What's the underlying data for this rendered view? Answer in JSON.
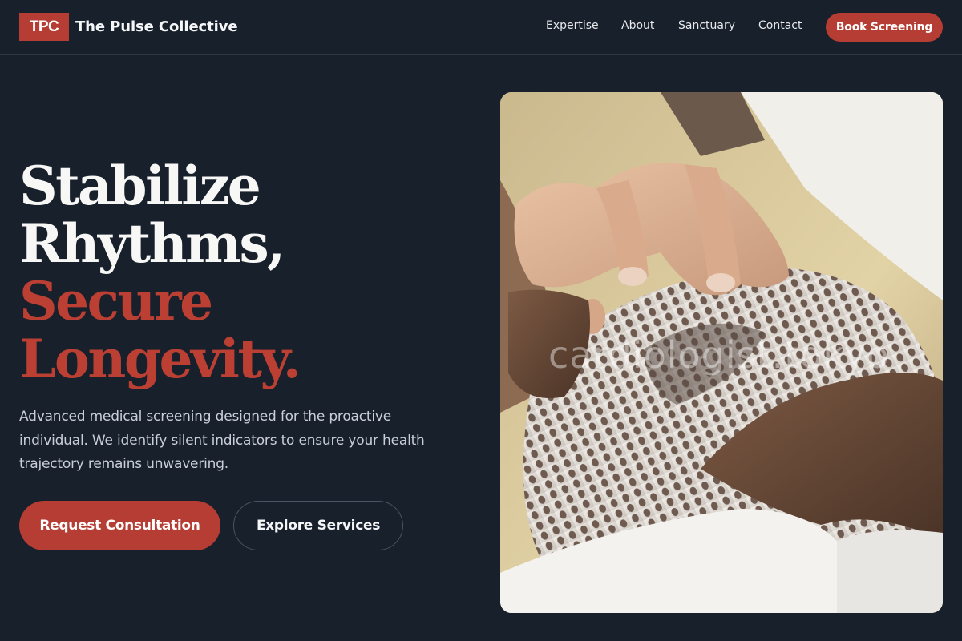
{
  "header": {
    "logo_text": "TPC",
    "brand_name": "The Pulse Collective",
    "nav": {
      "expertise": "Expertise",
      "about": "About",
      "sanctuary": "Sanctuary",
      "contact": "Contact"
    },
    "cta_label": "Book Screening"
  },
  "hero": {
    "headline": {
      "line1": "Stabilize",
      "line2": "Rhythms,",
      "line3": "Secure",
      "line4": "Longevity."
    },
    "description": "Advanced medical screening designed for the proactive individual. We identify silent indicators to ensure your health trajectory remains unwavering.",
    "primary_cta": "Request Consultation",
    "secondary_cta": "Explore Services",
    "image": {
      "watermark": "cardiologist.tokyo"
    }
  },
  "colors": {
    "background": "#18202b",
    "accent": "#b63d33",
    "text": "#f5f6f8",
    "muted_text": "#c9ced8"
  }
}
